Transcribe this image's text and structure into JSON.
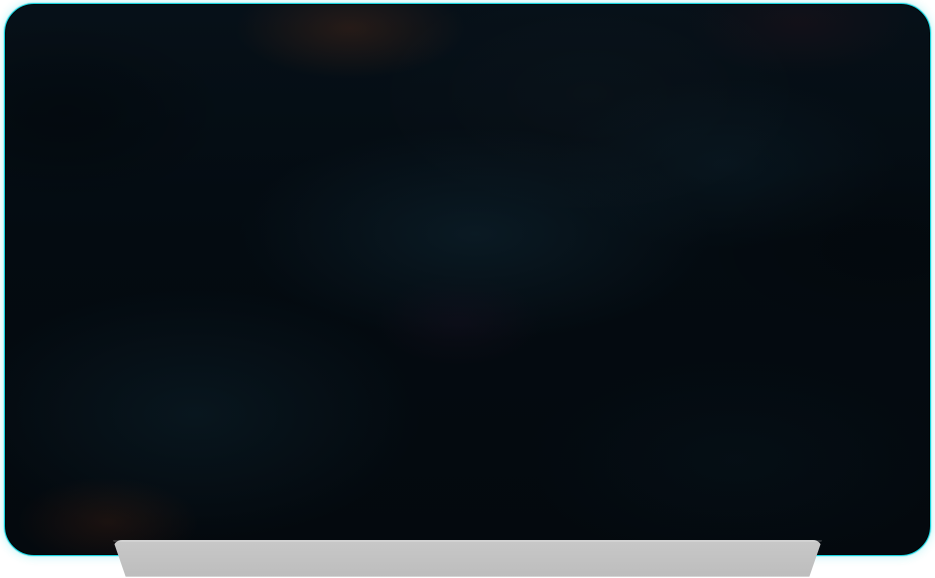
{
  "app": {
    "title": ""
  },
  "screen": {
    "accent_color": "#18d3df"
  },
  "dock": {
    "visible": true
  }
}
